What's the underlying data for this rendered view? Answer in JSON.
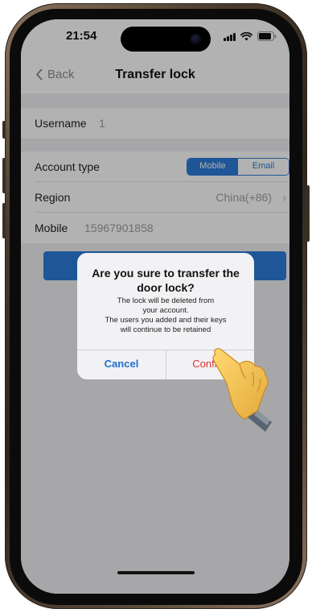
{
  "status_bar": {
    "time": "21:54"
  },
  "nav": {
    "back_label": "Back",
    "title": "Transfer lock"
  },
  "form": {
    "username_label": "Username",
    "username_value": "1",
    "account_type_label": "Account type",
    "account_type_options": [
      "Mobile",
      "Email"
    ],
    "account_type_selected": "Mobile",
    "region_label": "Region",
    "region_value": "China(+86)",
    "mobile_label": "Mobile",
    "mobile_value": "15967901858"
  },
  "alert": {
    "title": "Are you sure to transfer the door lock?",
    "message_line1": "The lock will be deleted from",
    "message_line2": "your account.",
    "message_line3": "The users you added and their keys",
    "message_line4": "will continue to be retained",
    "cancel_label": "Cancel",
    "confirm_label": "Confirm"
  },
  "colors": {
    "accent": "#2b7bd8",
    "confirm_red": "#e0302b",
    "cancel_blue": "#1f6fd0",
    "phone_frame": "#4a3a2c"
  },
  "icons": {
    "back": "chevron-left-icon",
    "region_arrow": "chevron-right-icon",
    "signal": "cellular-signal-icon",
    "wifi": "wifi-icon",
    "battery": "battery-icon",
    "pointer": "pointing-hand-icon"
  }
}
